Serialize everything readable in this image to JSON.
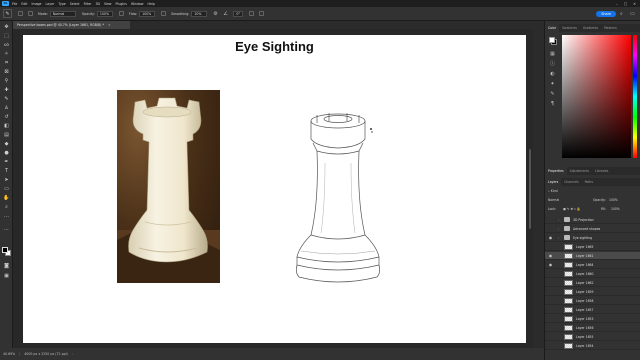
{
  "menubar": {
    "app_logo": "Ps",
    "items": [
      "File",
      "Edit",
      "Image",
      "Layer",
      "Type",
      "Select",
      "Filter",
      "3D",
      "View",
      "Plugins",
      "Window",
      "Help"
    ]
  },
  "options": {
    "mode_label": "Mode:",
    "mode_value": "Normal",
    "opacity_label": "Opacity:",
    "opacity_value": "100%",
    "flow_label": "Flow:",
    "flow_value": "100%",
    "smoothing_label": "Smoothing:",
    "smoothing_value": "10%",
    "angle_value": "0°",
    "share_label": "Share"
  },
  "document": {
    "tab_title": "Perspective boxes.psd @ 40.7% (Layer 1661, RGB/8) *",
    "close_glyph": "×"
  },
  "canvas": {
    "title": "Eye Sighting"
  },
  "status": {
    "zoom": "40.69%",
    "doc_size": "4000 px x 2250 px (72 ppi)"
  },
  "color_panel": {
    "tabs": [
      "Color",
      "Swatches",
      "Gradients",
      "Patterns"
    ]
  },
  "properties_panel": {
    "tabs": [
      "Properties",
      "Adjustments",
      "Libraries"
    ]
  },
  "layers_panel": {
    "tabs": [
      "Layers",
      "Channels",
      "Paths"
    ],
    "search_placeholder": "Kind",
    "blend_mode": "Normal",
    "opacity_label": "Opacity:",
    "opacity_value": "100%",
    "lock_label": "Lock:",
    "fill_label": "Fill:",
    "fill_value": "100%",
    "layers": [
      {
        "name": "3D Projection",
        "type": "group",
        "visible": false,
        "selected": false
      },
      {
        "name": "Advanced shapes",
        "type": "group",
        "visible": false,
        "selected": false
      },
      {
        "name": "Eye sighting",
        "type": "group",
        "visible": true,
        "selected": false
      },
      {
        "name": "Layer 1665",
        "type": "layer",
        "visible": false,
        "selected": false
      },
      {
        "name": "Layer 1661",
        "type": "layer",
        "visible": true,
        "selected": true
      },
      {
        "name": "Layer 1664",
        "type": "layer",
        "visible": true,
        "selected": false
      },
      {
        "name": "Layer 1660",
        "type": "layer",
        "visible": false,
        "selected": false
      },
      {
        "name": "Layer 1662",
        "type": "layer",
        "visible": false,
        "selected": false
      },
      {
        "name": "Layer 1659",
        "type": "layer",
        "visible": false,
        "selected": false
      },
      {
        "name": "Layer 1658",
        "type": "layer",
        "visible": false,
        "selected": false
      },
      {
        "name": "Layer 1657",
        "type": "layer",
        "visible": false,
        "selected": false
      },
      {
        "name": "Layer 1653",
        "type": "layer",
        "visible": false,
        "selected": false
      },
      {
        "name": "Layer 1656",
        "type": "layer",
        "visible": false,
        "selected": false
      },
      {
        "name": "Layer 1655",
        "type": "layer",
        "visible": false,
        "selected": false
      },
      {
        "name": "Layer 1654",
        "type": "layer",
        "visible": false,
        "selected": false
      }
    ]
  },
  "colors": {
    "accent": "#1473e6",
    "fg_swatch": "#000000",
    "bg_swatch": "#ffffff"
  },
  "icons": {
    "tools": [
      "move-icon",
      "artboard-icon",
      "marquee-icon",
      "lasso-icon",
      "quick-select-icon",
      "crop-icon",
      "frame-icon",
      "eyedropper-icon",
      "healing-icon",
      "brush-icon",
      "clone-stamp-icon",
      "history-brush-icon",
      "eraser-icon",
      "gradient-icon",
      "blur-icon",
      "dodge-icon",
      "pen-icon",
      "type-icon",
      "path-select-icon",
      "rectangle-icon",
      "hand-icon",
      "zoom-icon",
      "more-tools-icon"
    ]
  }
}
